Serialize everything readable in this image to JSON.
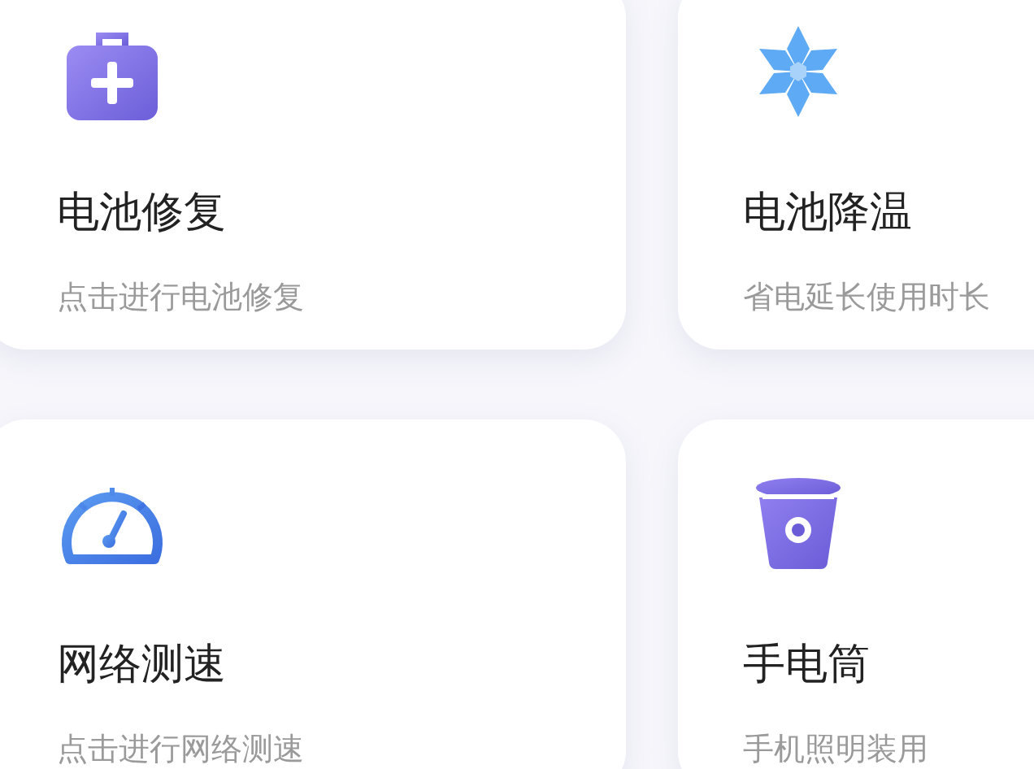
{
  "cards": [
    {
      "title": "电池修复",
      "subtitle": "点击进行电池修复"
    },
    {
      "title": "电池降温",
      "subtitle": "省电延长使用时长"
    },
    {
      "title": "网络测速",
      "subtitle": "点击进行网络测速"
    },
    {
      "title": "手电筒",
      "subtitle": "手机照明装用"
    }
  ]
}
